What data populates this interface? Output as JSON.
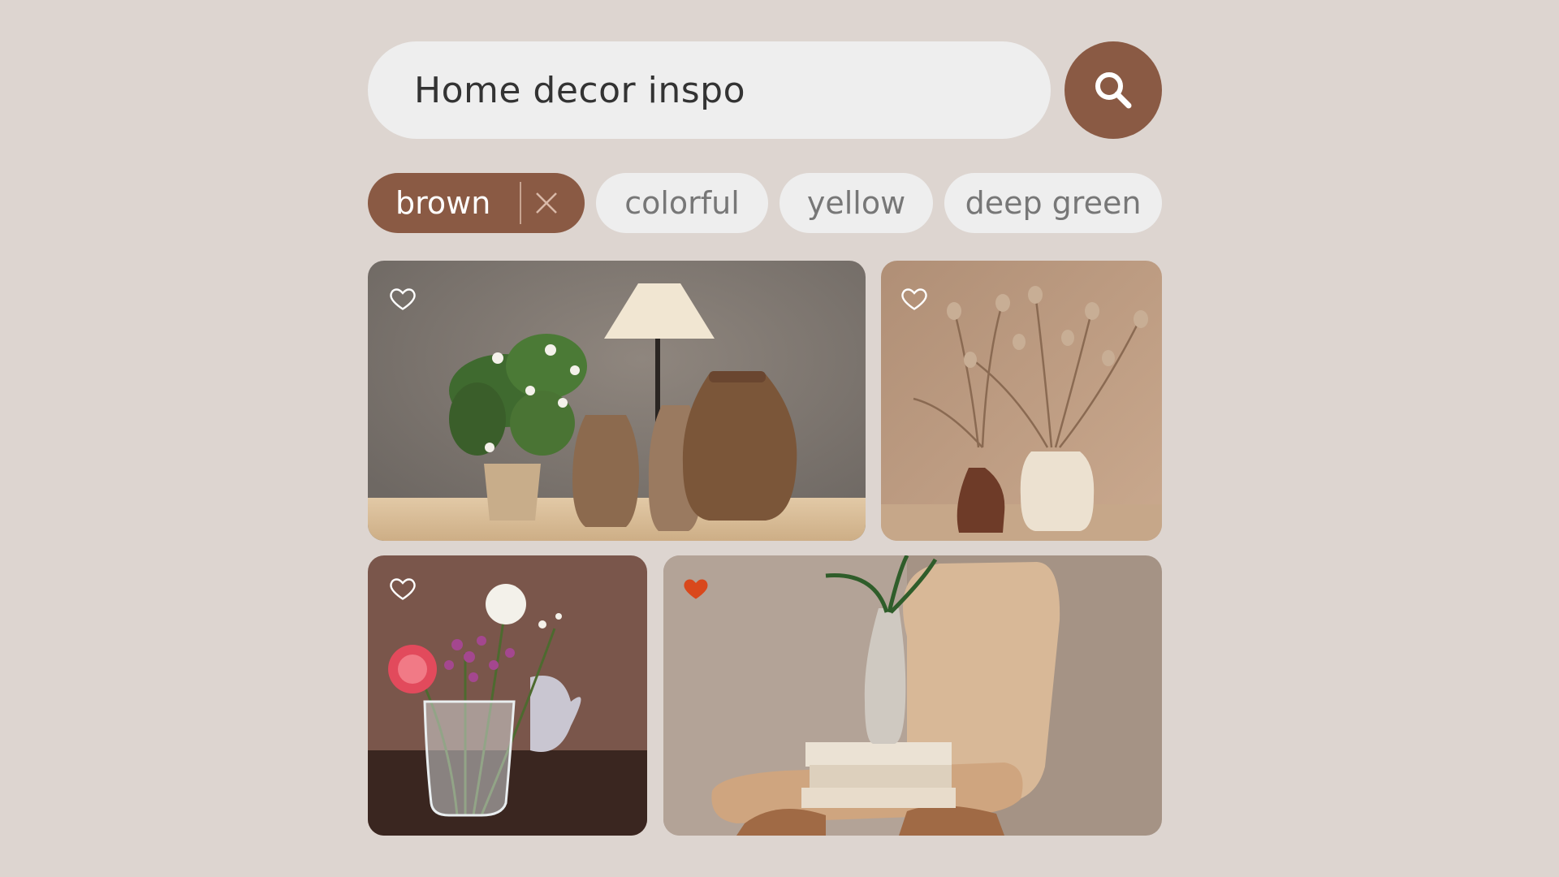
{
  "search": {
    "query": "Home decor inspo",
    "button_icon": "search-icon"
  },
  "filters": [
    {
      "label": "brown",
      "active": true
    },
    {
      "label": "colorful",
      "active": false
    },
    {
      "label": "yellow",
      "active": false
    },
    {
      "label": "deep green",
      "active": false
    }
  ],
  "results": [
    {
      "scene": "potted plant, table lamp and three clay vases",
      "liked": false
    },
    {
      "scene": "dried flower stems in two vases",
      "liked": false
    },
    {
      "scene": "pink and white flowers in a glass jug",
      "liked": false
    },
    {
      "scene": "wooden chair with books and a bud vase",
      "liked": true
    }
  ],
  "colors": {
    "background": "#ddd5d0",
    "accent": "#8a5a44",
    "chip_bg": "#eeeeee",
    "liked_heart": "#d9481c"
  }
}
